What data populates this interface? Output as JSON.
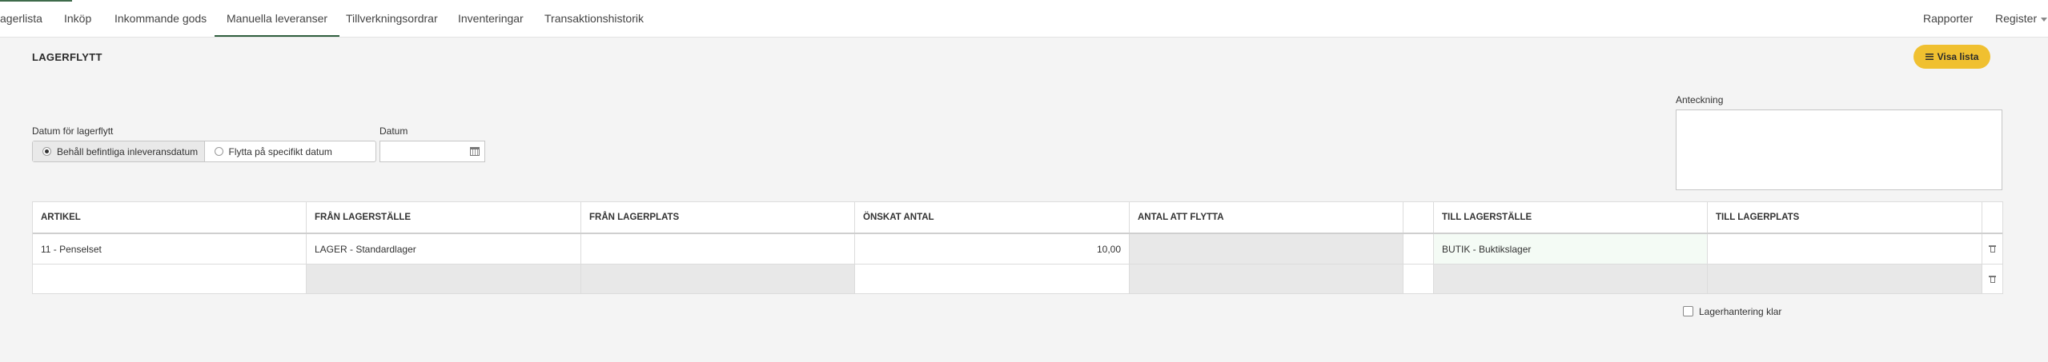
{
  "nav": {
    "items": [
      "agerlista",
      "Inköp",
      "Inkommande gods",
      "Manuella leveranser",
      "Tillverkningsordrar",
      "Inventeringar",
      "Transaktionshistorik"
    ],
    "active_index": 3,
    "right": {
      "rapporter": "Rapporter",
      "register": "Register"
    }
  },
  "page": {
    "title": "LAGERFLYTT",
    "visa_lista": "Visa lista"
  },
  "form": {
    "datum_for_lagerflytt_label": "Datum för lagerflytt",
    "option_keep": "Behåll befintliga inleveransdatum",
    "option_specific": "Flytta på specifikt datum",
    "selected_option": "option_keep",
    "datum_label": "Datum",
    "datum_value": "",
    "anteckning_label": "Anteckning",
    "anteckning_value": ""
  },
  "table": {
    "headers": [
      "ARTIKEL",
      "FRÅN LAGERSTÄLLE",
      "FRÅN LAGERPLATS",
      "ÖNSKAT ANTAL",
      "ANTAL ATT FLYTTA",
      "",
      "TILL LAGERSTÄLLE",
      "TILL LAGERPLATS"
    ],
    "rows": [
      [
        "11 - Penselset",
        "LAGER - Standardlager",
        "",
        "10,00",
        "",
        "",
        "BUTIK - Buktikslager",
        ""
      ],
      [
        "",
        "",
        "",
        "",
        "",
        "",
        "",
        ""
      ]
    ]
  },
  "footer": {
    "lagerhantering_klar": "Lagerhantering klar",
    "lagerhantering_klar_checked": false
  },
  "icons": {
    "visa_lista": "list-icon",
    "date": "calendar-icon",
    "row_delete": "trash-icon",
    "register_menu": "chevron-down-icon"
  },
  "colors": {
    "accent": "#2f5f3e",
    "button_yellow": "#f0c030"
  }
}
